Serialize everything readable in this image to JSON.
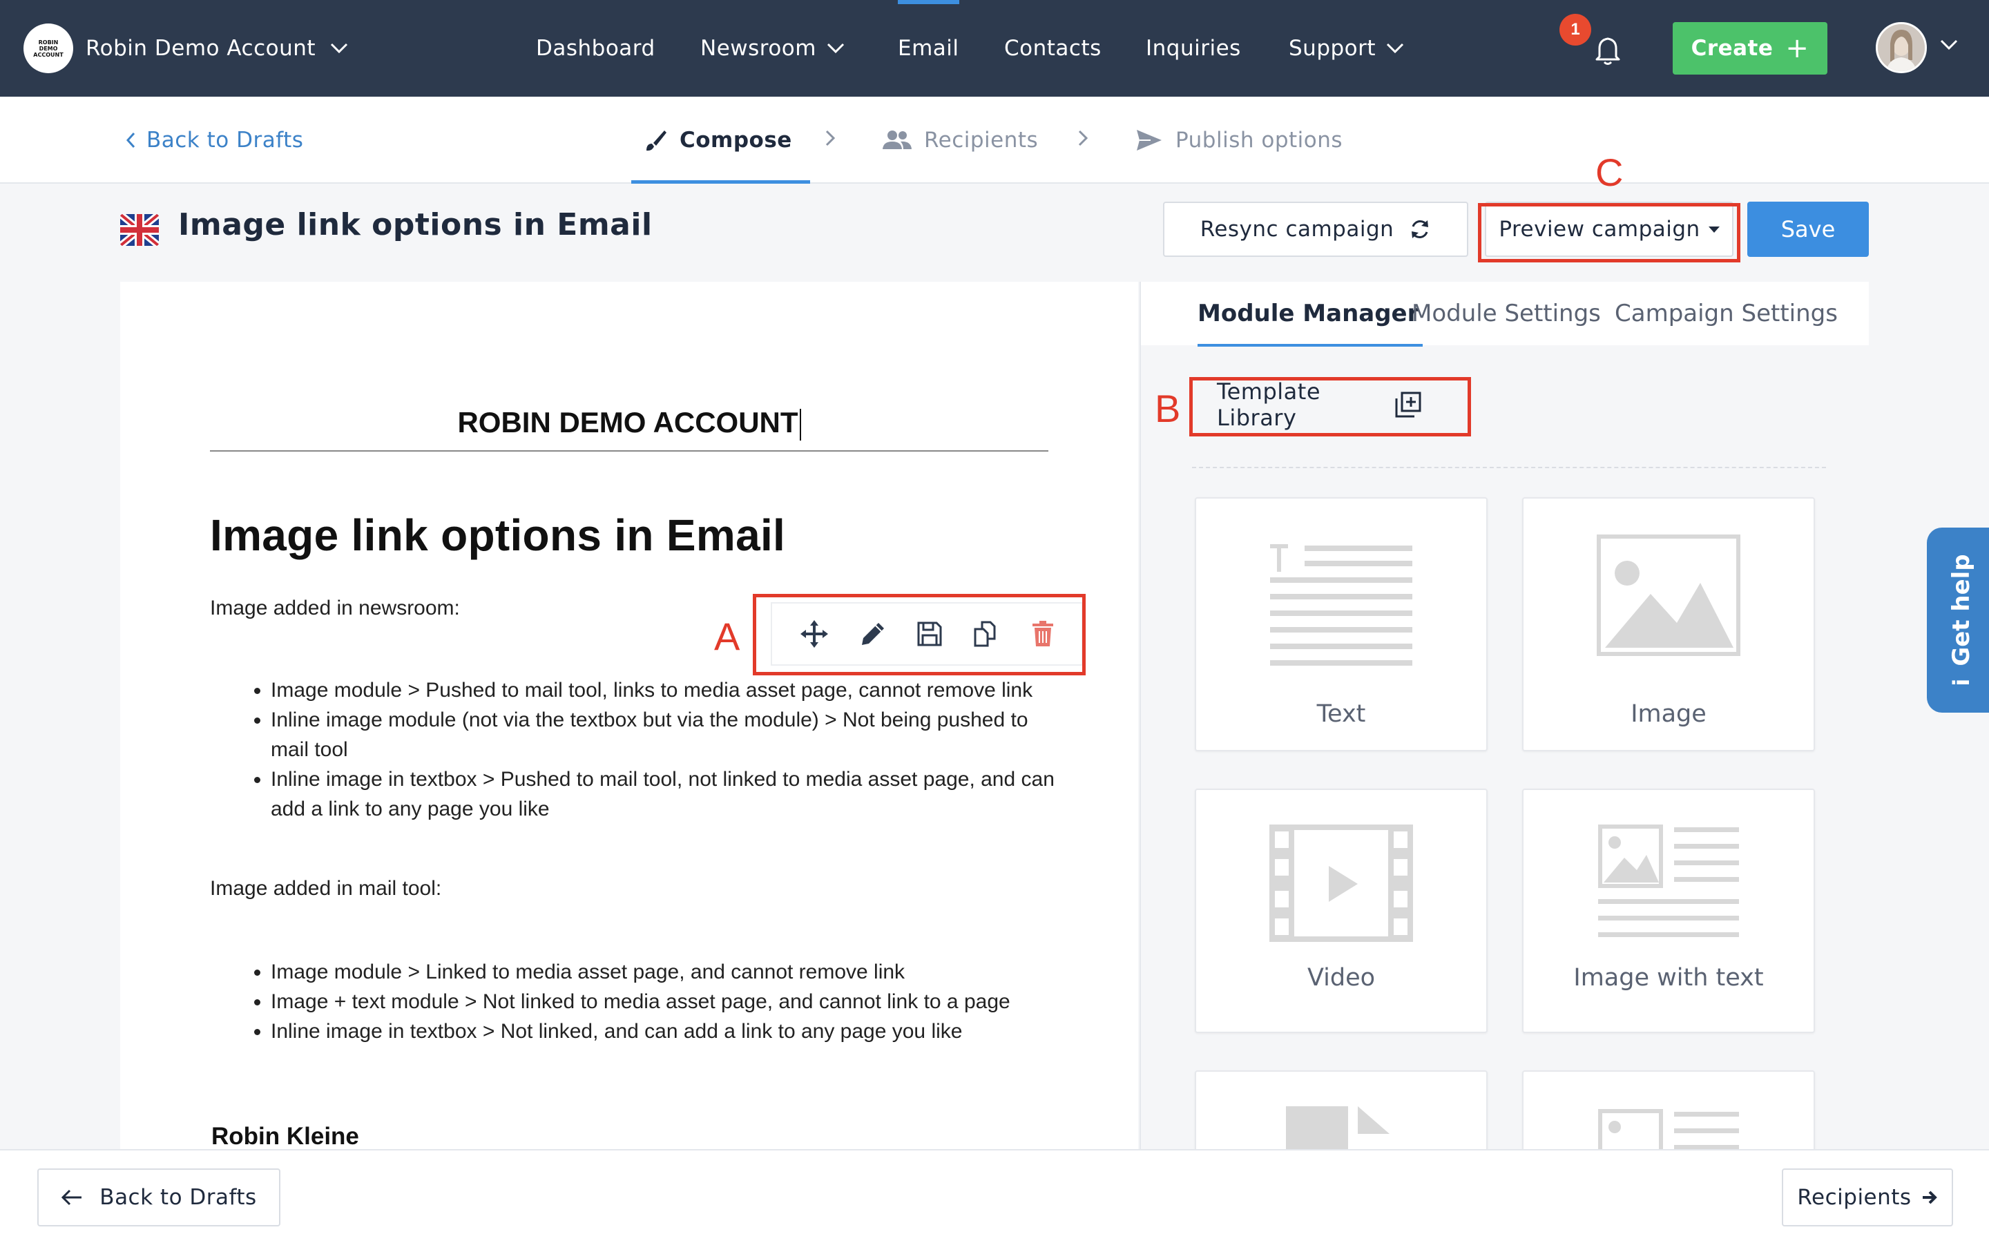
{
  "topnav": {
    "account_logo_text": "ROBIN DEMO ACCOUNT",
    "account_name": "Robin Demo Account",
    "items": [
      {
        "label": "Dashboard"
      },
      {
        "label": "Newsroom"
      },
      {
        "label": "Email",
        "active": true
      },
      {
        "label": "Contacts"
      },
      {
        "label": "Inquiries"
      },
      {
        "label": "Support"
      }
    ],
    "notification_count": "1",
    "create_label": "Create"
  },
  "stepsbar": {
    "back_label": "Back to Drafts",
    "steps": [
      {
        "label": "Compose",
        "icon": "brush-icon",
        "active": true
      },
      {
        "label": "Recipients",
        "icon": "people-icon"
      },
      {
        "label": "Publish options",
        "icon": "send-icon"
      }
    ]
  },
  "titlebar": {
    "title": "Image link options in Email",
    "resync_label": "Resync campaign",
    "preview_label": "Preview campaign",
    "save_label": "Save"
  },
  "annotations": {
    "a": "A",
    "b": "B",
    "c": "C"
  },
  "email": {
    "brand": "ROBIN DEMO ACCOUNT",
    "heading": "Image link options in Email",
    "section1_intro": "Image added in newsroom:",
    "section1_items": [
      "Image module > Pushed to mail tool, links to media asset page, cannot remove link",
      "Inline image module (not via the textbox but via the module) > Not being pushed to mail tool",
      "Inline image in textbox > Pushed to mail tool, not linked to media asset page, and can add a link to any page you like"
    ],
    "section2_intro": "Image added in mail tool:",
    "section2_items": [
      "Image module > Linked to media asset page, and cannot remove link",
      "Image + text module > Not linked to media asset page, and cannot link to a page",
      "Inline image in textbox > Not linked, and can add a link to any page you like"
    ],
    "signature": "Robin Kleine"
  },
  "panel": {
    "tabs": [
      {
        "label": "Module Manager",
        "active": true
      },
      {
        "label": "Module Settings"
      },
      {
        "label": "Campaign Settings"
      }
    ],
    "template_library_label": "Template Library",
    "modules": [
      {
        "label": "Text",
        "icon": "text-module-icon"
      },
      {
        "label": "Image",
        "icon": "image-module-icon"
      },
      {
        "label": "Video",
        "icon": "video-module-icon"
      },
      {
        "label": "Image with text",
        "icon": "image-with-text-module-icon"
      }
    ]
  },
  "gethelp_label": "Get help",
  "footer": {
    "back_label": "Back to Drafts",
    "next_label": "Recipients"
  }
}
